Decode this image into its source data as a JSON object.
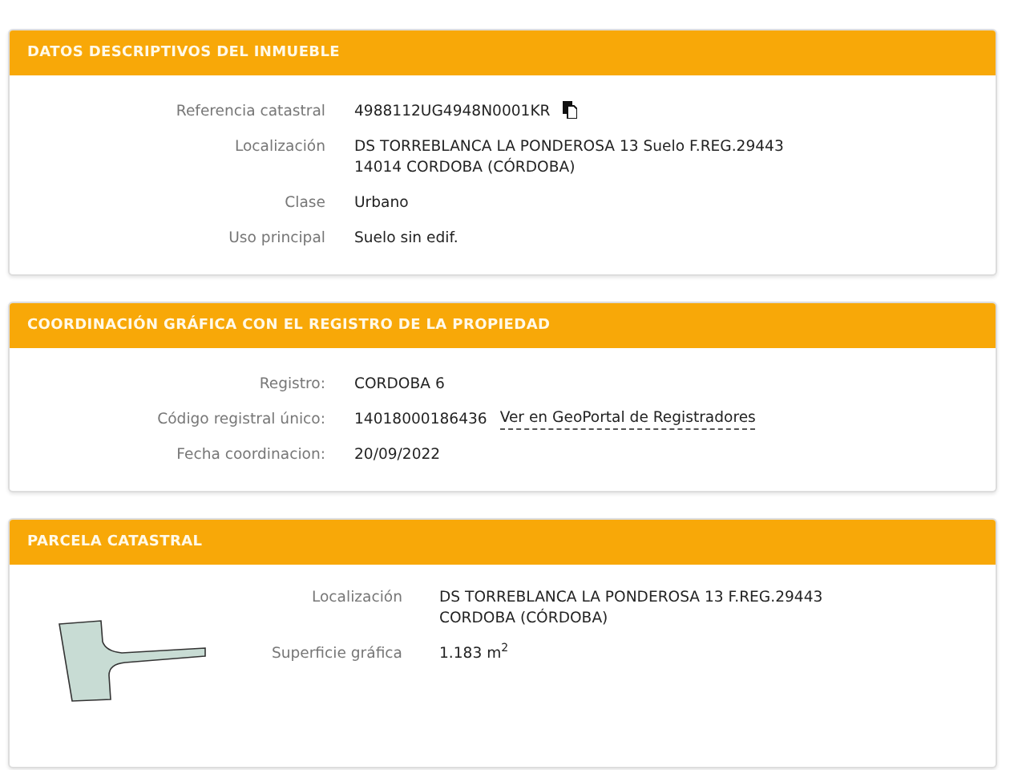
{
  "panels": [
    {
      "title": "DATOS DESCRIPTIVOS DEL INMUEBLE",
      "kind": "fields",
      "rows": [
        {
          "label": "Referencia catastral",
          "lines": [
            "4988112UG4948N0001KR"
          ],
          "copy_icon": true
        },
        {
          "label": "Localización",
          "lines": [
            "DS TORREBLANCA LA PONDEROSA 13 Suelo F.REG.29443",
            "14014 CORDOBA (CÓRDOBA)"
          ]
        },
        {
          "label": "Clase",
          "lines": [
            "Urbano"
          ]
        },
        {
          "label": "Uso principal",
          "lines": [
            "Suelo sin edif."
          ]
        }
      ]
    },
    {
      "title": "COORDINACIÓN GRÁFICA CON EL REGISTRO DE LA PROPIEDAD",
      "kind": "fields",
      "rows": [
        {
          "label": "Registro:",
          "lines": [
            "CORDOBA 6"
          ]
        },
        {
          "label": "Código registral único:",
          "lines": [
            "14018000186436"
          ],
          "link": "Ver en GeoPortal de Registradores"
        },
        {
          "label": "Fecha coordinacion:",
          "lines": [
            "20/09/2022"
          ]
        }
      ]
    },
    {
      "title": "PARCELA CATASTRAL",
      "kind": "parcel",
      "rows": [
        {
          "label": "Localización",
          "lines": [
            "DS TORREBLANCA LA PONDEROSA 13 F.REG.29443",
            "CORDOBA (CÓRDOBA)"
          ]
        },
        {
          "label": "Superficie gráfica",
          "lines": [
            "1.183 m$^{2}$"
          ]
        }
      ]
    }
  ]
}
